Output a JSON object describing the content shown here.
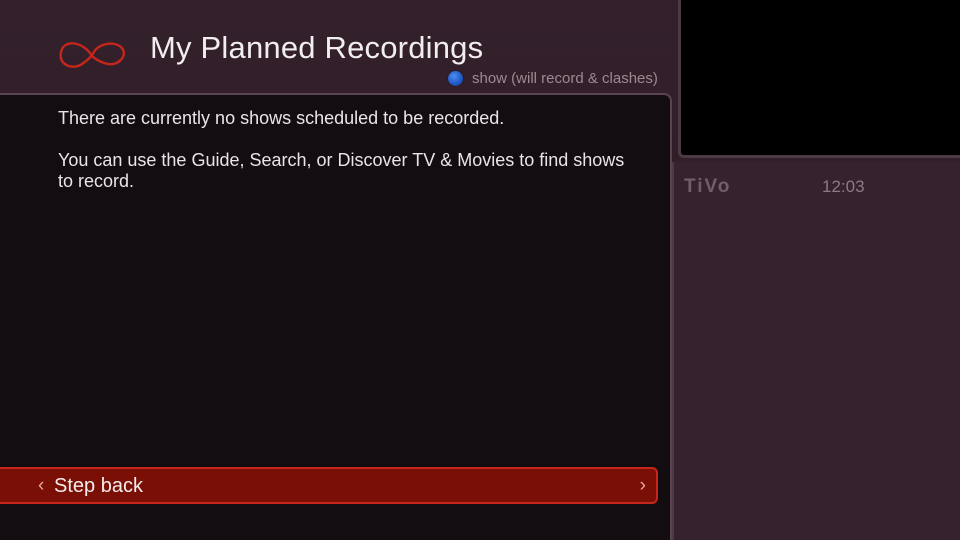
{
  "header": {
    "title": "My Planned Recordings",
    "legend_text": "show (will record & clashes)",
    "legend_color": "#2a62d4",
    "logo_icon": "virgin-infinity-icon"
  },
  "content": {
    "message_1": "There are currently no shows scheduled to be recorded.",
    "message_2": "You can use the Guide, Search, or Discover TV & Movies to find shows to record."
  },
  "step_back": {
    "label": "Step back",
    "left_icon": "chevron-left-icon",
    "right_icon": "chevron-right-icon",
    "accent_color": "#7a0f05"
  },
  "side": {
    "brand": "TiVo",
    "clock": "12:03"
  }
}
